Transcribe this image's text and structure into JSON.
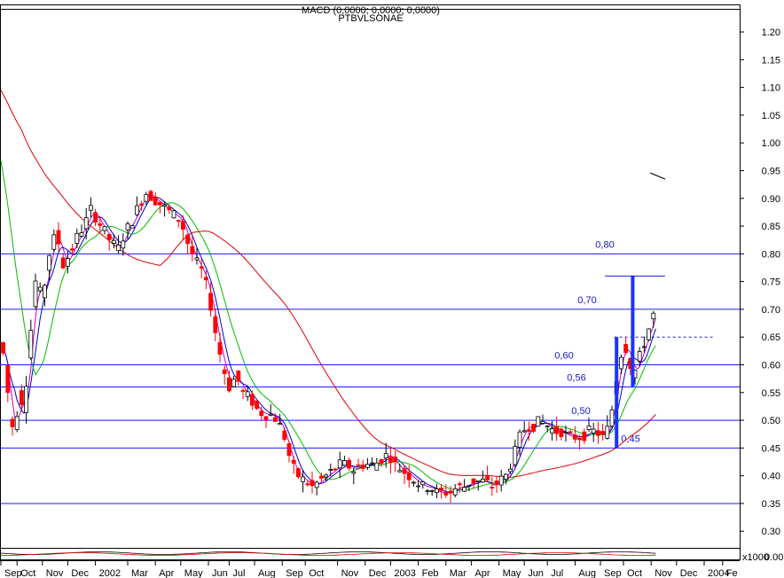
{
  "header": {
    "title_line1": "MACD (0,0000; 0,0000; 0,0000)",
    "title_line2": "PTBVLSONAE"
  },
  "colors": {
    "hline": "#1a1aff",
    "ma_short": "#0000cc",
    "ma_mid": "#cc00cc",
    "ma_green": "#00bb00",
    "ma_red": "#dd0000",
    "candle_up": "#ffffff",
    "candle_down": "#ff0000",
    "annotation_bar": "#1a33ff"
  },
  "chart_data": {
    "type": "candlestick",
    "ylim": [
      0.27,
      1.24
    ],
    "y_ticks": [
      0.3,
      0.35,
      0.4,
      0.45,
      0.5,
      0.55,
      0.6,
      0.65,
      0.7,
      0.75,
      0.8,
      0.85,
      0.9,
      0.95,
      1.0,
      1.05,
      1.1,
      1.15,
      1.2
    ],
    "y_tick_labels": [
      "0.30",
      "0.35",
      "0.40",
      "0.45",
      "0.50",
      "0.55",
      "0.60",
      "0.65",
      "0.70",
      "0.75",
      "0.80",
      "0.85",
      "0.90",
      "0.95",
      "1.00",
      "1.05",
      "1.10",
      "1.15",
      "1.20"
    ],
    "x_labels": [
      "Sep",
      "Oct",
      "Nov",
      "Dec",
      "2002",
      "Mar",
      "Apr",
      "May",
      "Jun",
      "Jul",
      "Aug",
      "Sep",
      "Oct",
      "Nov",
      "Dec",
      "2003",
      "Feb",
      "Mar",
      "Apr",
      "May",
      "Jun",
      "Jul",
      "Aug",
      "Sep",
      "Oct",
      "Nov",
      "Dec",
      "2004",
      "Fe"
    ],
    "x_label_positions": [
      0,
      7,
      18,
      29,
      41,
      55,
      67,
      78,
      90,
      99,
      110,
      122,
      132,
      146,
      158,
      169,
      181,
      193,
      204,
      216,
      227,
      237,
      249,
      260,
      270,
      282,
      293,
      305,
      313
    ],
    "n_bars": 320,
    "horizontal_lines": [
      {
        "value": 0.8,
        "label": "0,80"
      },
      {
        "value": 0.7,
        "label": "0,70"
      },
      {
        "value": 0.6,
        "label": "0,60"
      },
      {
        "value": 0.56,
        "label": "0,56"
      },
      {
        "value": 0.5,
        "label": "0,50"
      },
      {
        "value": 0.45,
        "label": "0,45"
      },
      {
        "value": 0.35,
        "label": ""
      }
    ],
    "dashed_line": {
      "value": 0.65,
      "from_bar": 266
    },
    "price_anchors": [
      [
        0,
        0.64
      ],
      [
        2,
        0.6
      ],
      [
        4,
        0.5
      ],
      [
        6,
        0.48
      ],
      [
        8,
        0.55
      ],
      [
        10,
        0.52
      ],
      [
        12,
        0.62
      ],
      [
        15,
        0.75
      ],
      [
        18,
        0.72
      ],
      [
        21,
        0.8
      ],
      [
        24,
        0.84
      ],
      [
        27,
        0.78
      ],
      [
        30,
        0.8
      ],
      [
        33,
        0.83
      ],
      [
        36,
        0.85
      ],
      [
        39,
        0.88
      ],
      [
        42,
        0.86
      ],
      [
        45,
        0.84
      ],
      [
        48,
        0.82
      ],
      [
        51,
        0.81
      ],
      [
        54,
        0.84
      ],
      [
        57,
        0.86
      ],
      [
        60,
        0.89
      ],
      [
        63,
        0.91
      ],
      [
        66,
        0.9
      ],
      [
        69,
        0.89
      ],
      [
        72,
        0.88
      ],
      [
        75,
        0.87
      ],
      [
        78,
        0.86
      ],
      [
        81,
        0.82
      ],
      [
        84,
        0.79
      ],
      [
        87,
        0.77
      ],
      [
        90,
        0.73
      ],
      [
        93,
        0.66
      ],
      [
        96,
        0.6
      ],
      [
        99,
        0.56
      ],
      [
        102,
        0.58
      ],
      [
        105,
        0.55
      ],
      [
        108,
        0.54
      ],
      [
        111,
        0.52
      ],
      [
        114,
        0.51
      ],
      [
        117,
        0.51
      ],
      [
        120,
        0.5
      ],
      [
        123,
        0.47
      ],
      [
        126,
        0.42
      ],
      [
        129,
        0.4
      ],
      [
        132,
        0.39
      ],
      [
        135,
        0.38
      ],
      [
        138,
        0.39
      ],
      [
        141,
        0.4
      ],
      [
        144,
        0.41
      ],
      [
        147,
        0.42
      ],
      [
        150,
        0.42
      ],
      [
        153,
        0.41
      ],
      [
        156,
        0.42
      ],
      [
        159,
        0.42
      ],
      [
        162,
        0.42
      ],
      [
        165,
        0.43
      ],
      [
        168,
        0.44
      ],
      [
        171,
        0.42
      ],
      [
        174,
        0.41
      ],
      [
        177,
        0.4
      ],
      [
        180,
        0.39
      ],
      [
        183,
        0.38
      ],
      [
        186,
        0.38
      ],
      [
        189,
        0.37
      ],
      [
        192,
        0.37
      ],
      [
        195,
        0.37
      ],
      [
        198,
        0.38
      ],
      [
        201,
        0.38
      ],
      [
        204,
        0.39
      ],
      [
        207,
        0.39
      ],
      [
        210,
        0.39
      ],
      [
        213,
        0.38
      ],
      [
        216,
        0.39
      ],
      [
        219,
        0.4
      ],
      [
        222,
        0.43
      ],
      [
        225,
        0.47
      ],
      [
        228,
        0.49
      ],
      [
        231,
        0.49
      ],
      [
        234,
        0.5
      ],
      [
        237,
        0.49
      ],
      [
        240,
        0.48
      ],
      [
        243,
        0.48
      ],
      [
        246,
        0.47
      ],
      [
        249,
        0.47
      ],
      [
        252,
        0.47
      ],
      [
        255,
        0.48
      ],
      [
        258,
        0.48
      ],
      [
        261,
        0.47
      ],
      [
        264,
        0.49
      ],
      [
        266,
        0.55
      ],
      [
        268,
        0.6
      ],
      [
        270,
        0.64
      ],
      [
        272,
        0.62
      ],
      [
        274,
        0.58
      ],
      [
        276,
        0.6
      ],
      [
        278,
        0.63
      ],
      [
        280,
        0.65
      ],
      [
        282,
        0.68
      ],
      [
        284,
        0.7
      ]
    ],
    "annotation_bars": [
      {
        "bar": 267,
        "low": 0.45,
        "high": 0.65
      },
      {
        "bar": 274,
        "low": 0.56,
        "high": 0.76
      }
    ],
    "bracket_line": {
      "from_bar": 262,
      "to_bar": 288,
      "value": 0.76
    },
    "scale_note": "x1000",
    "oscillator_value_label": "0.00"
  }
}
